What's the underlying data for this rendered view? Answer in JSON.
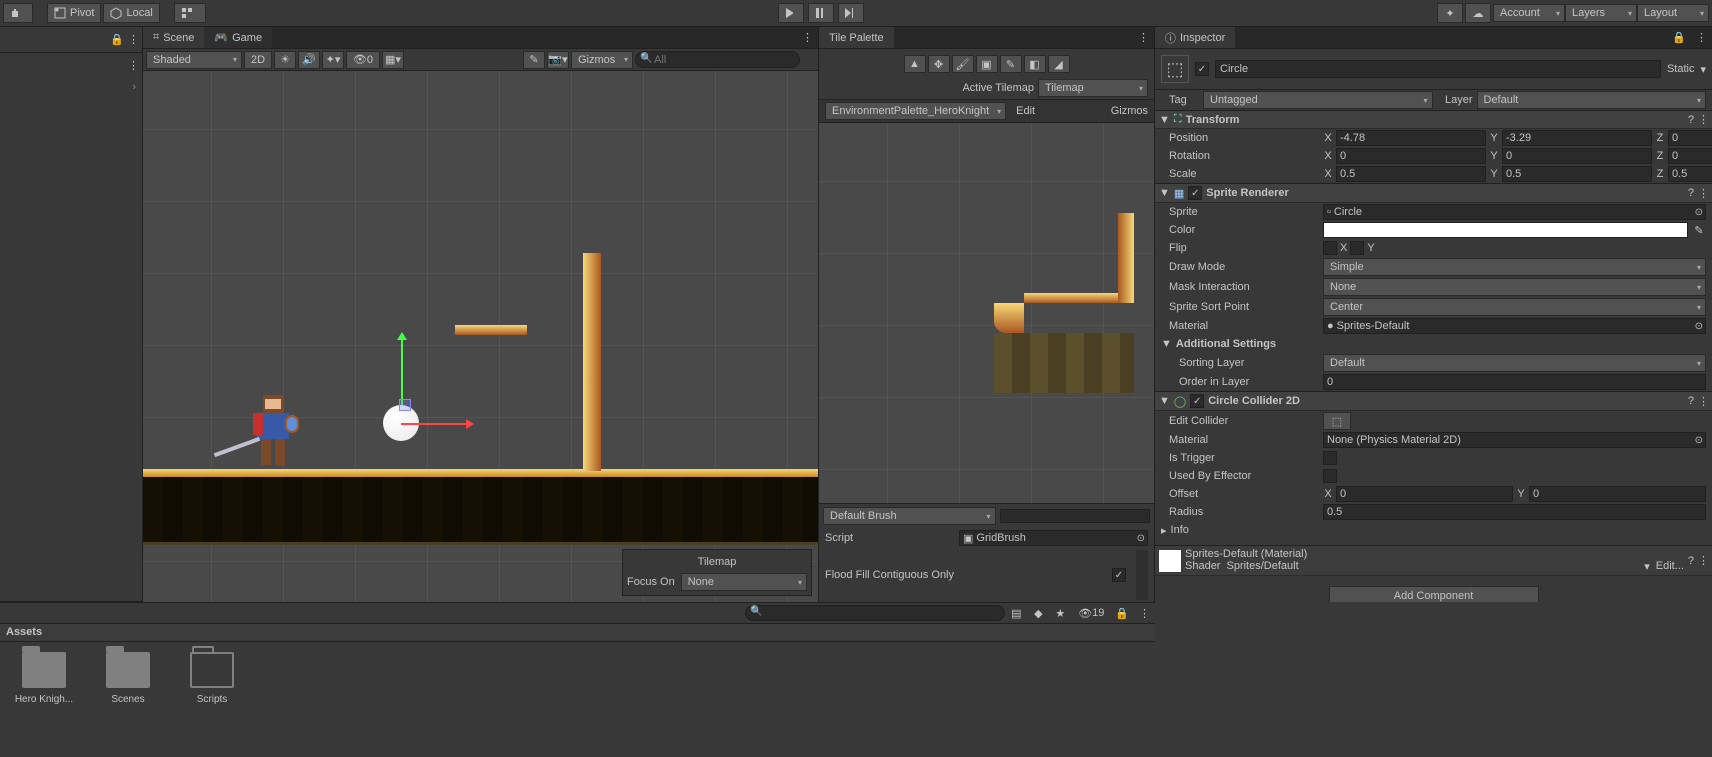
{
  "top_toolbar": {
    "pivot": "Pivot",
    "local": "Local",
    "account": "Account",
    "layers": "Layers",
    "layout": "Layout"
  },
  "scene_tab": "Scene",
  "game_tab": "Game",
  "scene_tools": {
    "shaded": "Shaded",
    "mode_2d": "2D",
    "hidden_count": "0",
    "gizmos": "Gizmos",
    "search_placeholder": "All"
  },
  "scene_overlay": {
    "tilemap": "Tilemap",
    "focus_on": "Focus On",
    "focus_value": "None"
  },
  "tile_palette": {
    "title": "Tile Palette",
    "active_tilemap_label": "Active Tilemap",
    "active_tilemap_value": "Tilemap",
    "palette_name": "EnvironmentPalette_HeroKnight",
    "edit": "Edit",
    "gizmos": "Gizmos",
    "default_brush": "Default Brush",
    "script_label": "Script",
    "script_value": "GridBrush",
    "flood_fill_label": "Flood Fill Contiguous Only"
  },
  "inspector": {
    "title": "Inspector",
    "object_name": "Circle",
    "static_label": "Static",
    "tag_label": "Tag",
    "tag_value": "Untagged",
    "layer_label": "Layer",
    "layer_value": "Default",
    "transform": {
      "title": "Transform",
      "position": "Position",
      "pos_x": "-4.78",
      "pos_y": "-3.29",
      "pos_z": "0",
      "rotation": "Rotation",
      "rot_x": "0",
      "rot_y": "0",
      "rot_z": "0",
      "scale": "Scale",
      "scl_x": "0.5",
      "scl_y": "0.5",
      "scl_z": "0.5"
    },
    "sprite_renderer": {
      "title": "Sprite Renderer",
      "sprite_label": "Sprite",
      "sprite_value": "Circle",
      "color_label": "Color",
      "flip_label": "Flip",
      "flip_x": "X",
      "flip_y": "Y",
      "draw_mode_label": "Draw Mode",
      "draw_mode_value": "Simple",
      "mask_label": "Mask Interaction",
      "mask_value": "None",
      "sort_point_label": "Sprite Sort Point",
      "sort_point_value": "Center",
      "material_label": "Material",
      "material_value": "Sprites-Default",
      "additional": "Additional Settings",
      "sorting_layer_label": "Sorting Layer",
      "sorting_layer_value": "Default",
      "order_label": "Order in Layer",
      "order_value": "0"
    },
    "collider": {
      "title": "Circle Collider 2D",
      "edit_collider": "Edit Collider",
      "material_label": "Material",
      "material_value": "None (Physics Material 2D)",
      "is_trigger": "Is Trigger",
      "used_by_effector": "Used By Effector",
      "offset_label": "Offset",
      "offset_x": "0",
      "offset_y": "0",
      "radius_label": "Radius",
      "radius_value": "0.5",
      "info": "Info"
    },
    "material_footer": {
      "name": "Sprites-Default (Material)",
      "shader_label": "Shader",
      "shader_value": "Sprites/Default",
      "edit": "Edit..."
    },
    "add_component": "Add Component"
  },
  "assets": {
    "title": "Assets",
    "hidden_count": "19",
    "items": [
      "Hero Knigh...",
      "Scenes",
      "Scripts"
    ]
  }
}
